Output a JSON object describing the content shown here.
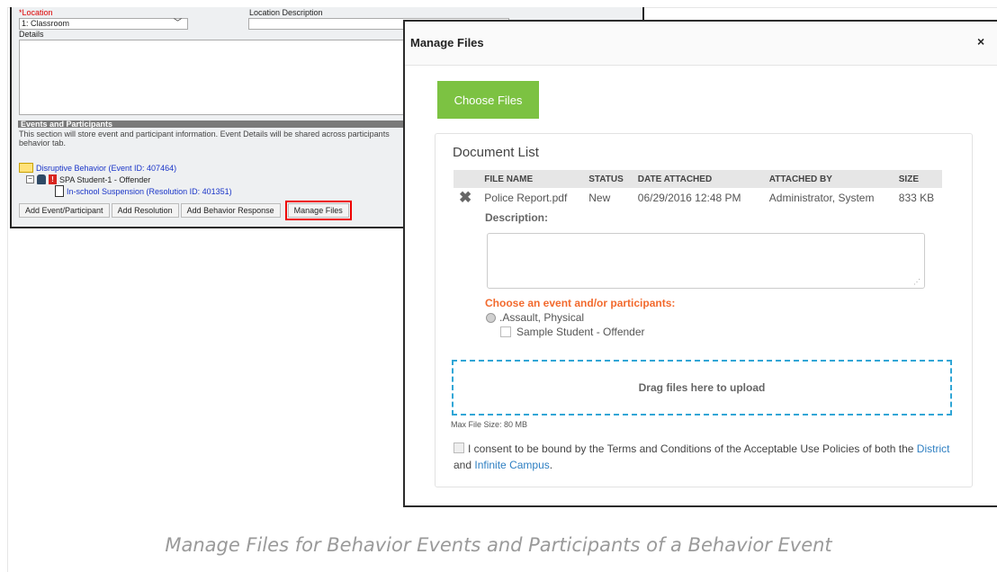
{
  "form": {
    "location_label": "*Location",
    "location_value": "1: Classroom",
    "location_desc_label": "Location Description",
    "details_label": "Details",
    "events_header": "Events and Participants",
    "events_help": "This section will store event and participant information. Event Details will be shared across participants behavior tab.",
    "tree": {
      "event": "Disruptive Behavior (Event ID: 407464)",
      "student": "SPA Student-1 - Offender",
      "resolution": "In-school Suspension (Resolution ID: 401351)"
    },
    "buttons": {
      "add_event": "Add Event/Participant",
      "add_resolution": "Add Resolution",
      "add_response": "Add Behavior Response",
      "manage_files": "Manage Files"
    }
  },
  "modal": {
    "title": "Manage Files",
    "close": "×",
    "choose_files": "Choose Files",
    "doc_list_title": "Document List",
    "columns": [
      "FILE NAME",
      "STATUS",
      "DATE ATTACHED",
      "ATTACHED BY",
      "SIZE"
    ],
    "file": {
      "name": "Police Report.pdf",
      "status": "New",
      "date": "06/29/2016 12:48 PM",
      "by": "Administrator, System",
      "size": "833 KB"
    },
    "description_label": "Description:",
    "choose_event_label": "Choose an event and/or participants:",
    "event_option": ".Assault, Physical",
    "participant_option": "Sample Student - Offender",
    "drop_text": "Drag files here to upload",
    "max_size": "Max File Size: 80 MB",
    "consent_text_1": "I consent to be bound by the Terms and Conditions of the Acceptable Use Policies of both the",
    "consent_link_district": "District",
    "consent_text_2": "and",
    "consent_link_campus": "Infinite Campus",
    "consent_end": "."
  },
  "caption": "Manage Files for Behavior Events and Participants of a Behavior Event",
  "colors": {
    "choose_button": "#7cc242",
    "drop_border": "#30a6d6",
    "choose_label": "#f26a2e",
    "link": "#2e7fc2",
    "highlight": "#ee0000"
  }
}
